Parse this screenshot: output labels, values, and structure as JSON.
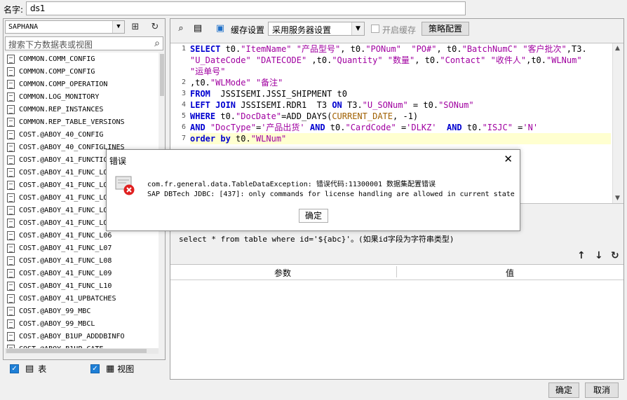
{
  "name_label": "名字:",
  "name_value": "ds1",
  "left": {
    "db_selected": "SAPHANA",
    "search_placeholder": "搜索下方数据表或视图",
    "tables": [
      "COMMON.COMM_CONFIG",
      "COMMON.COMP_CONFIG",
      "COMMON.COMP_OPERATION",
      "COMMON.LOG_MONITORY",
      "COMMON.REP_INSTANCES",
      "COMMON.REP_TABLE_VERSIONS",
      "COST.@ABOY_40_CONFIG",
      "COST.@ABOY_40_CONFIGLINES",
      "COST.@ABOY_41_FUNCTIC",
      "COST.@ABOY_41_FUNC_LO",
      "COST.@ABOY_41_FUNC_LO",
      "COST.@ABOY_41_FUNC_LO",
      "COST.@ABOY_41_FUNC_LO",
      "COST.@ABOY_41_FUNC_LO",
      "COST.@ABOY_41_FUNC_L06",
      "COST.@ABOY_41_FUNC_L07",
      "COST.@ABOY_41_FUNC_L08",
      "COST.@ABOY_41_FUNC_L09",
      "COST.@ABOY_41_FUNC_L10",
      "COST.@ABOY_41_UPBATCHES",
      "COST.@ABOY_99_MBC",
      "COST.@ABOY_99_MBCL",
      "COST.@ABOY_B1UP_ADDDBINFO",
      "COST.@ABOY_B1UP_CATE"
    ],
    "table_label": "表",
    "view_label": "视图"
  },
  "toolbar": {
    "cache_settings": "缓存设置",
    "cache_mode": "采用服务器设置",
    "enable_cache": "开启缓存",
    "policy_button": "策略配置"
  },
  "sql_lines": [
    {
      "no": "1",
      "html": "<span class=\"kw\">SELECT</span> t0.<span class=\"str\">\"ItemName\"</span> <span class=\"str\">\"产品型号\"</span>, t0.<span class=\"str\">\"PONum\"</span>  <span class=\"str\">\"PO#\"</span>, t0.<span class=\"str\">\"BatchNumC\"</span> <span class=\"str\">\"客户批次\"</span>,T3."
    },
    {
      "no": "",
      "html": "<span class=\"str\">\"U_DateCode\"</span> <span class=\"str\">\"DATECODE\"</span> ,t0.<span class=\"str\">\"Quantity\"</span> <span class=\"str\">\"数量\"</span>, t0.<span class=\"str\">\"Contact\"</span> <span class=\"str\">\"收件人\"</span>,t0.<span class=\"str\">\"WLNum\"</span>"
    },
    {
      "no": "",
      "html": "<span class=\"str\">\"运单号\"</span>"
    },
    {
      "no": "2",
      "html": ",t0.<span class=\"str\">\"WLMode\"</span> <span class=\"str\">\"备注\"</span>"
    },
    {
      "no": "3",
      "html": "<span class=\"kw\">FROM</span>  JSSISEMI.JSSI_SHIPMENT t0"
    },
    {
      "no": "4",
      "html": "<span class=\"kw\">LEFT JOIN</span> JSSISEMI.RDR1  T3 <span class=\"kw\">ON</span> T3.<span class=\"str\">\"U_SONum\"</span> = t0.<span class=\"str\">\"SONum\"</span>"
    },
    {
      "no": "5",
      "html": "<span class=\"kw\">WHERE</span> t0.<span class=\"str\">\"DocDate\"</span>=ADD_DAYS(<span class=\"fn\">CURRENT_DATE</span>, -1)"
    },
    {
      "no": "6",
      "html": "<span class=\"kw\">AND</span> <span class=\"str\">\"DocType\"</span>=<span class=\"str\">'产品出货'</span> <span class=\"kw\">AND</span> t0.<span class=\"str\">\"CardCode\"</span> =<span class=\"str\">'DLKZ'</span>  <span class=\"kw\">AND</span> t0.<span class=\"str\">\"ISJC\"</span> =<span class=\"str\">'N'</span>"
    },
    {
      "no": "7",
      "html": "<span class=\"kw\">order by</span> t0.<span class=\"str\">\"WLNum\"</span>"
    }
  ],
  "hint": "select * from table where id='${abc}'。(如果id字段为字符串类型)",
  "param_table": {
    "col_param": "参数",
    "col_value": "值"
  },
  "dialog": {
    "title": "错误",
    "message1": "com.fr.general.data.TableDataException: 错误代码:11300001 数据集配置错误",
    "message2": "SAP DBTech JDBC: [437]: only commands for license handling are allowed in current state",
    "ok": "确定"
  },
  "footer": {
    "ok": "确定",
    "cancel": "取消"
  }
}
